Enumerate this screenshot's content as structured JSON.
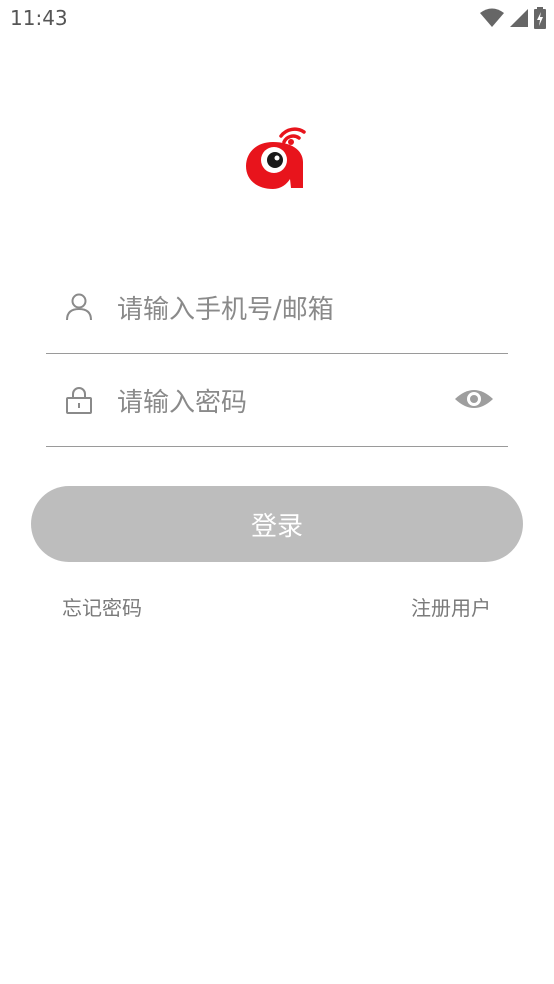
{
  "status_bar": {
    "time": "11:43",
    "icons": [
      "wifi-icon",
      "signal-icon",
      "battery-charging-icon"
    ]
  },
  "logo": {
    "icon": "app-logo-icon",
    "colors": {
      "primary": "#e8141c",
      "eye": "#1a1a1a"
    }
  },
  "form": {
    "username_placeholder": "请输入手机号/邮箱",
    "password_placeholder": "请输入密码",
    "username_icon": "user-icon",
    "password_icon": "lock-icon",
    "visibility_icon": "eye-icon"
  },
  "login_button": {
    "label": "登录",
    "color": "#bdbdbd"
  },
  "links": {
    "forgot_password": "忘记密码",
    "register": "注册用户"
  }
}
